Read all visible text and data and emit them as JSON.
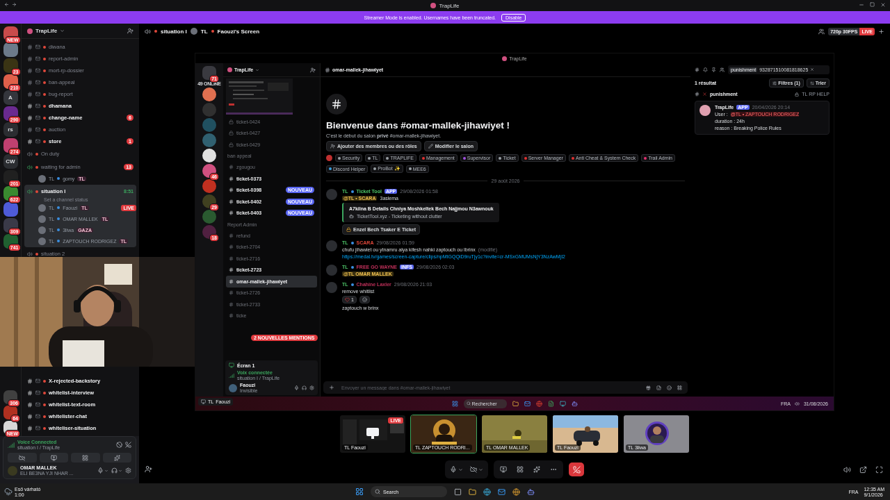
{
  "window": {
    "title": "TrapLife"
  },
  "banner": {
    "text": "Streamer Mode is enabled. Usernames have been truncated.",
    "button": "Disable"
  },
  "servers_top": [
    {
      "color": "#c94b4b",
      "badge": "NEW"
    },
    {
      "color": "#6c7a8a"
    },
    {
      "color": "#3a3414",
      "badge": "23"
    },
    {
      "color": "#e0604a",
      "badge": "210"
    },
    {
      "color": "#34363c",
      "initials": "A"
    },
    {
      "color": "#6a2a90",
      "badge": "290"
    },
    {
      "color": "#2b2d31",
      "initials": "rs"
    },
    {
      "color": "#c04070",
      "badge": "274"
    },
    {
      "color": "#2b2d31",
      "initials": "CW"
    },
    {
      "color": "#202020",
      "badge": "201"
    },
    {
      "color": "#3a8a30",
      "badge": "622"
    },
    {
      "color": "#4e5bd8"
    },
    {
      "color": "#3a3a48",
      "badge": "309"
    },
    {
      "color": "#206030",
      "badge": "741"
    }
  ],
  "servers_bottom": [
    {
      "color": "#404040",
      "badge": "306"
    },
    {
      "color": "#b03020",
      "badge": "64"
    },
    {
      "color": "#d8d8d8",
      "badge": "NEW"
    }
  ],
  "sidebar": {
    "title": "TrapLife",
    "channels": [
      {
        "kind": "text",
        "name": "diwana",
        "unread": false
      },
      {
        "kind": "text",
        "name": "report-admin",
        "unread": false
      },
      {
        "kind": "text",
        "name": "mort-rp-dossier",
        "unread": false
      },
      {
        "kind": "text",
        "name": "ban-appeal",
        "unread": false
      },
      {
        "kind": "text",
        "name": "bug-report",
        "unread": false
      },
      {
        "kind": "text",
        "name": "dhamana",
        "unread": true
      },
      {
        "kind": "text",
        "name": "change-name",
        "unread": true,
        "badge": "6"
      },
      {
        "kind": "text",
        "name": "auction",
        "unread": false
      },
      {
        "kind": "text",
        "name": "store",
        "unread": true,
        "badge": "1"
      },
      {
        "kind": "voice",
        "name": "On duty",
        "selected": false
      },
      {
        "kind": "voice",
        "name": "waiting for admin",
        "selected": false,
        "badge": "13",
        "children": [
          {
            "prefix": "TL",
            "name": "gomy",
            "tag": "TL"
          }
        ]
      },
      {
        "kind": "voice",
        "name": "situation I",
        "selected": true,
        "timer": "8:51",
        "status": "Set a channel status",
        "children": [
          {
            "prefix": "TL",
            "name": "Faouzi",
            "tag": "TL",
            "live": "LIVE"
          },
          {
            "prefix": "TL",
            "name": "OMAR MALLEK",
            "tag": "TL"
          },
          {
            "prefix": "TL",
            "name": "3liwa",
            "tag": "GAZA"
          },
          {
            "prefix": "TL",
            "name": "ZAPTOUCH RODRIGEZ",
            "tag": "TL"
          }
        ]
      },
      {
        "kind": "voice",
        "name": "situation 2",
        "selected": false
      }
    ],
    "channels_bottom": [
      {
        "kind": "text",
        "name": "X-rejected-backstory",
        "unread": true
      },
      {
        "kind": "text",
        "name": "whitelist-interview",
        "unread": true
      },
      {
        "kind": "text",
        "name": "whitelist-text-room",
        "unread": true
      },
      {
        "kind": "text",
        "name": "whitelister-chat",
        "unread": true
      },
      {
        "kind": "text",
        "name": "whiteliser-situation",
        "unread": true
      }
    ]
  },
  "voice_panel": {
    "status": "Voice Connected",
    "location": "situation I / TrapLife"
  },
  "user_panel": {
    "name": "OMAR MALLEK",
    "status": "ELI BE3NA YJI NHAR ..."
  },
  "stream_header": {
    "channel": "situation I",
    "prefix": "TL",
    "title": "Faouzi's Screen",
    "quality": "720p 30FPS",
    "live": "LIVE"
  },
  "inner": {
    "title": "TrapLife",
    "online": "49 ONLINE",
    "servers": [
      {
        "color": "#3a3a40",
        "badge": "71"
      },
      {
        "color": "#e07050"
      },
      {
        "color": "#303030"
      },
      {
        "color": "#205060"
      },
      {
        "color": "#306070"
      },
      {
        "color": "#e0e0e0"
      },
      {
        "color": "#d05080",
        "badge": "46"
      },
      {
        "color": "#c03020"
      },
      {
        "color": "#404020",
        "badge": "29"
      },
      {
        "color": "#2a5a30"
      },
      {
        "color": "#502040",
        "badge": "18"
      }
    ],
    "server_name": "TrapLife",
    "channels": [
      {
        "kind": "channel",
        "name": "ticket-0424",
        "locked": true,
        "unread": false
      },
      {
        "kind": "channel",
        "name": "ticket-0427",
        "locked": true,
        "unread": false
      },
      {
        "kind": "channel",
        "name": "ticket-0429",
        "locked": true,
        "unread": false
      },
      {
        "kind": "category",
        "name": "ban appeal"
      },
      {
        "kind": "channel",
        "name": "zgougou",
        "locked": false,
        "unread": false
      },
      {
        "kind": "channel",
        "name": "ticket-0373",
        "locked": false,
        "unread": true
      },
      {
        "kind": "channel",
        "name": "ticket-0398",
        "locked": false,
        "unread": true,
        "badge": "NOUVEAU"
      },
      {
        "kind": "channel",
        "name": "ticket-0402",
        "locked": false,
        "unread": true,
        "badge": "NOUVEAU"
      },
      {
        "kind": "channel",
        "name": "ticket-0403",
        "locked": false,
        "unread": true,
        "badge": "NOUVEAU"
      },
      {
        "kind": "category",
        "name": "Report Admin"
      },
      {
        "kind": "channel",
        "name": "refund",
        "locked": false,
        "unread": false
      },
      {
        "kind": "channel",
        "name": "ticket-2704",
        "locked": false,
        "unread": false
      },
      {
        "kind": "channel",
        "name": "ticket-2716",
        "locked": false,
        "unread": false
      },
      {
        "kind": "channel",
        "name": "ticket-2723",
        "locked": false,
        "unread": true
      },
      {
        "kind": "channel",
        "name": "omar-mallek-jihawiyet",
        "locked": false,
        "unread": true,
        "selected": true
      },
      {
        "kind": "channel",
        "name": "ticket-2726",
        "locked": false,
        "unread": false
      },
      {
        "kind": "channel",
        "name": "ticket-2733",
        "locked": false,
        "unread": false
      },
      {
        "kind": "channel",
        "name": "ticke",
        "locked": false,
        "unread": false
      }
    ],
    "mentions": "2 NOUVELLES MENTIONS",
    "voice": {
      "screen": "Écran 1",
      "status": "Voix connectée",
      "location": "situation I / TrapLife"
    },
    "user": {
      "name": "Faouzi",
      "status": "Invisible"
    },
    "chat": {
      "channel": "omar-mallek-jihawiyet",
      "welcome": "Bienvenue dans #omar-mallek-jihawiyet !",
      "intro": "C'est le début du salon **privé** #omar-mallek-jihawiyet.",
      "buttons": [
        "Ajouter des membres ou des rôles",
        "Modifier le salon"
      ],
      "roles": [
        {
          "name": "Security",
          "color": "#9aa0a6"
        },
        {
          "name": "TL",
          "color": "#9aa0a6"
        },
        {
          "name": "TRAPLIFE",
          "color": "#9aa0a6"
        },
        {
          "name": "Management",
          "color": "#e03030"
        },
        {
          "name": "Supervisor",
          "color": "#a050e0"
        },
        {
          "name": "Ticket",
          "color": "#9aa0a6"
        },
        {
          "name": "Server Manager",
          "color": "#e03030"
        },
        {
          "name": "Anti Cheat & System Check",
          "color": "#e03030"
        },
        {
          "name": "Trail Admin",
          "color": "#e03070"
        },
        {
          "name": "Discord Helper",
          "color": "#3aa0e0"
        },
        {
          "name": "ProBot ✨",
          "color": "#9aa0a6"
        },
        {
          "name": "MEE6",
          "color": "#9aa0a6"
        }
      ],
      "date": "29 août 2026",
      "messages": [
        {
          "prefix": "TL",
          "author": "Ticket Tool",
          "color": "#4fc96a",
          "badge": "APP",
          "time": "29/08/2026 01:58",
          "mention": "@TL • SCARA",
          "text": "3aslema",
          "embed": {
            "title": "A7kilna B Details Chniya Moshkeltek Bech Najjmou N3awnouk",
            "footer": "TicketTool.xyz - Ticketing without clutter"
          },
          "button": "Enzel Bech Tsaker E Ticket"
        },
        {
          "prefix": "TL",
          "author": "SCARA",
          "color": "#e0483a",
          "time": "29/08/2026 01:59",
          "text": "chufu jihawiet ou ytnamru alya kifesh nahki zaptouch ou lbrinx",
          "edited": "(modifié)",
          "link": "https://medal.tv/games/screen-capture/clips/npMtGQQiD9ruTjy1c?invite=cr-MSxGMUMsNjY3NzAwMjI2"
        },
        {
          "prefix": "TL",
          "author": "FREE GO WAYNE",
          "color": "#c0305a",
          "badge": "INFS",
          "time": "29/08/2026 02:03",
          "mention": "@TL OMAR MALLEK"
        },
        {
          "prefix": "TL",
          "author": "Chahine Laxler",
          "color": "#c0305a",
          "time": "29/08/2026 21:03",
          "text": "remove whitlist",
          "reaction": "1",
          "followup": "zaptouch w brinx"
        }
      ],
      "placeholder": "Envoyer un message dans #omar-mallek-jihawiyet"
    },
    "search": {
      "scope": "punishment",
      "query": "932871510081818625",
      "count": "1 résultat",
      "filters": "Filtres (1)",
      "sort": "Trier",
      "result": {
        "channel": "punishment",
        "category": "TL RP HELP",
        "author": "TrapLife",
        "badge": "APP",
        "time": "20/04/2026 20:14",
        "lines": [
          {
            "label": "User :",
            "mention": "@TL • ZAPTOUCH RODRIGEZ"
          },
          {
            "label": "duration : 24h"
          },
          {
            "label": "reason : Breaking Police Rules"
          }
        ]
      }
    },
    "taskbar": {
      "popup": "Faouzi",
      "popup_prefix": "TL",
      "search": "Rechercher",
      "lang": "FRA",
      "date": "31/08/2026"
    }
  },
  "tiles": [
    {
      "kind": "screen",
      "prefix": "TL",
      "name": "Faouzi",
      "live": "LIVE",
      "speaking": false
    },
    {
      "kind": "picture",
      "prefix": "TL",
      "name": "ZAPTOUCH RODRI...",
      "speaking": true
    },
    {
      "kind": "picture",
      "prefix": "TL",
      "name": "OMAR MALLEK",
      "speaking": false
    },
    {
      "kind": "picture",
      "prefix": "TL",
      "name": "Faouzi",
      "speaking": false
    },
    {
      "kind": "picture",
      "prefix": "TL",
      "name": "3liwa",
      "speaking": false
    }
  ],
  "taskbar": {
    "weather": "Eső várható",
    "weather_time": "1:00",
    "search": "Search",
    "lang": "FRA",
    "time": "12:35 AM",
    "date": "9/1/2026"
  }
}
